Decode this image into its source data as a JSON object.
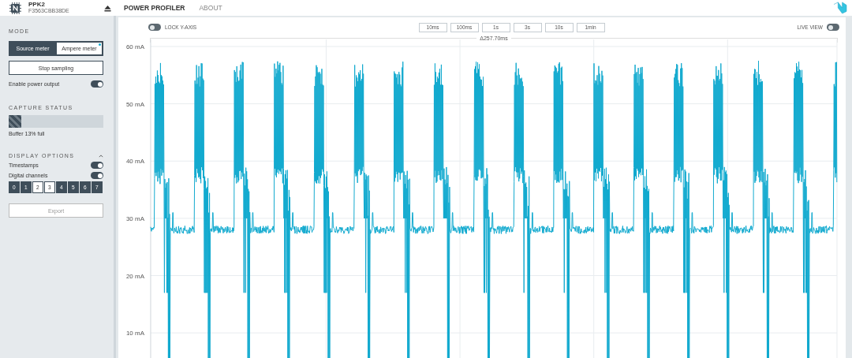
{
  "header": {
    "device_name": "PPK2",
    "serial": "F3563CBB38DE",
    "nav": [
      {
        "label": "POWER PROFILER",
        "selected": true
      },
      {
        "label": "ABOUT",
        "selected": false
      }
    ]
  },
  "sidebar": {
    "mode": {
      "heading": "MODE",
      "options": [
        {
          "label": "Source meter",
          "selected": false
        },
        {
          "label": "Ampere meter",
          "selected": true
        }
      ]
    },
    "sampling_button": "Stop sampling",
    "power_output": {
      "label": "Enable power output",
      "on": true
    },
    "capture_status": {
      "heading": "CAPTURE STATUS",
      "level": 0.13,
      "caption": "Buffer 13% full"
    },
    "display_options": {
      "heading": "DISPLAY OPTIONS",
      "expanded": true,
      "toggles": [
        {
          "label": "Timestamps",
          "on": true
        },
        {
          "label": "Digital channels",
          "on": true
        }
      ],
      "channels": [
        {
          "label": "0",
          "selected": true
        },
        {
          "label": "1",
          "selected": true
        },
        {
          "label": "2",
          "selected": false
        },
        {
          "label": "3",
          "selected": false
        },
        {
          "label": "4",
          "selected": true
        },
        {
          "label": "5",
          "selected": true
        },
        {
          "label": "6",
          "selected": true
        },
        {
          "label": "7",
          "selected": true
        }
      ]
    },
    "export_button": "Export"
  },
  "chart_toolbar": {
    "lock_y_axis": {
      "label": "LOCK Y-AXIS",
      "on": false
    },
    "windows": [
      {
        "label": "10ms"
      },
      {
        "label": "100ms"
      },
      {
        "label": "1s"
      },
      {
        "label": "3s"
      },
      {
        "label": "10s"
      },
      {
        "label": "1min"
      }
    ],
    "live_view": {
      "label": "LIVE VIEW",
      "on": false
    },
    "span": "Δ257.70ms"
  },
  "chart": {
    "y_ticks": [
      "60 mA",
      "50 mA",
      "40 mA",
      "30 mA",
      "20 mA",
      "10 mA"
    ]
  }
}
